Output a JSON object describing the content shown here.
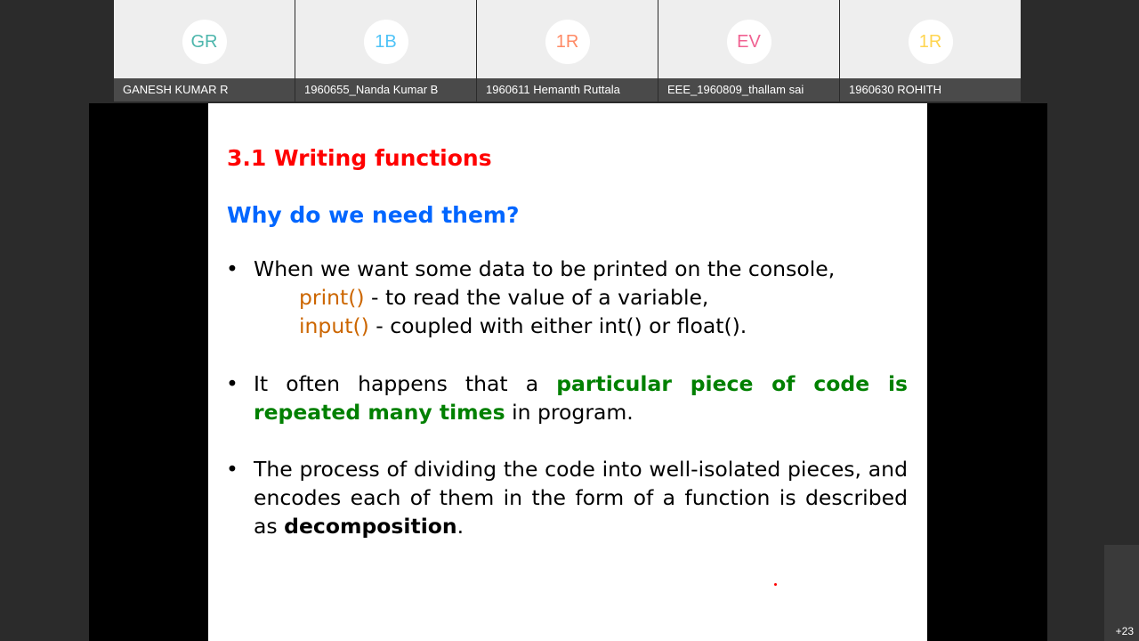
{
  "participants": [
    {
      "initials": "GR",
      "name": "GANESH KUMAR R",
      "color": "#4db6ac"
    },
    {
      "initials": "1B",
      "name": "1960655_Nanda Kumar B",
      "color": "#4fc3f7"
    },
    {
      "initials": "1R",
      "name": "1960611 Hemanth Ruttala",
      "color": "#ff8a65"
    },
    {
      "initials": "EV",
      "name": "EEE_1960809_thallam sai",
      "color": "#f06292"
    },
    {
      "initials": "1R",
      "name": "1960630 ROHITH",
      "color": "#ffd54f"
    }
  ],
  "slide": {
    "title": "3.1 Writing functions",
    "subtitle": "Why do we need them?",
    "bullets": [
      {
        "marker": "•",
        "line1": "When we want some data to be printed on the console,",
        "line2_fn": "print()",
        "line2_rest": " -  to read the value of a variable,",
        "line3_fn": "input()",
        "line3_rest": " -  coupled with either int() or float()."
      },
      {
        "marker": "•",
        "text_before": "It often happens that a ",
        "highlight": "particular piece of code is repeated many times",
        "text_after": " in program."
      },
      {
        "marker": "•",
        "text_before": "The process of dividing the code into well-isolated pieces, and encodes each of them in the form of a function is described as ",
        "emphasis": "decomposition",
        "text_after": "."
      }
    ]
  },
  "more_participants": "+23",
  "colors": {
    "title": "#ff0000",
    "subtitle": "#0066ff",
    "function_name": "#cc6600",
    "highlight": "#008000"
  }
}
